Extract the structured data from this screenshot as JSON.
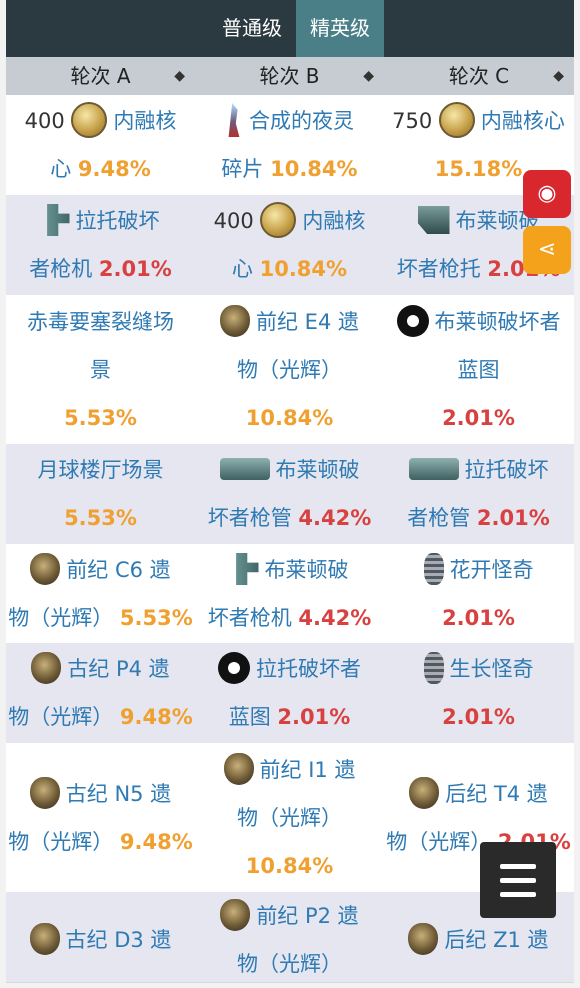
{
  "tabs": {
    "normal": "普通级",
    "elite": "精英级"
  },
  "header": {
    "col_a": "轮次 A",
    "col_b": "轮次 B",
    "col_c": "轮次 C",
    "sort_glyph": "◆"
  },
  "rows": [
    {
      "a": {
        "prefix": "400",
        "icon": "core-icon",
        "l1": "内融核",
        "l2": "心",
        "pct": "9.48%"
      },
      "b": {
        "icon": "night-icon",
        "l1": "合成的夜灵",
        "l2": "碎片",
        "pct": "10.84%"
      },
      "c": {
        "prefix": "750",
        "icon": "core-icon",
        "l1": "内融核心",
        "l2": "",
        "pct": "15.18%"
      }
    },
    {
      "a": {
        "icon": "receiver-icon",
        "l1": "拉托破坏",
        "l2": "者枪机",
        "pct": "2.01%"
      },
      "b": {
        "prefix": "400",
        "icon": "core-icon",
        "l1": "内融核",
        "l2": "心",
        "pct": "10.84%"
      },
      "c": {
        "icon": "stock-icon",
        "l1": "布莱顿破",
        "l2": "坏者枪托",
        "pct": "2.01%"
      }
    },
    {
      "a": {
        "l1": "赤毒要塞裂缝场",
        "l2": "景",
        "pct": "5.53%"
      },
      "b": {
        "icon": "relic-icon",
        "l1": "前纪 E4 遗",
        "l2": "物（光辉）",
        "l3": "",
        "pct": "10.84%"
      },
      "c": {
        "icon": "blueprint-icon",
        "l1": "布莱顿破坏者",
        "l2": "蓝图",
        "pct": "2.01%"
      }
    },
    {
      "a": {
        "l1": "月球楼厅场景",
        "l2": "",
        "pct": "5.53%"
      },
      "b": {
        "icon": "barrel-icon",
        "l1": "布莱顿破",
        "l2": "坏者枪管",
        "pct": "4.42%"
      },
      "c": {
        "icon": "barrel-icon",
        "l1": "拉托破坏",
        "l2": "者枪管",
        "pct": "2.01%"
      }
    },
    {
      "a": {
        "icon": "relic-icon",
        "l1": "前纪 C6 遗",
        "l2": "物（光辉）",
        "pct": "5.53%"
      },
      "b": {
        "icon": "receiver-icon",
        "l1": "布莱顿破",
        "l2": "坏者枪机",
        "pct": "4.42%"
      },
      "c": {
        "icon": "bloom-icon",
        "l1": "花开怪奇",
        "l2": "",
        "pct": "2.01%"
      }
    },
    {
      "a": {
        "icon": "relic-icon",
        "l1": "古纪 P4 遗",
        "l2": "物（光辉）",
        "pct": "9.48%"
      },
      "b": {
        "icon": "blueprint-icon",
        "l1": "拉托破坏者",
        "l2": "蓝图",
        "pct": "2.01%"
      },
      "c": {
        "icon": "bloom-icon",
        "l1": "生长怪奇",
        "l2": "",
        "pct": "2.01%"
      }
    },
    {
      "a": {
        "icon": "relic-icon",
        "l1": "古纪 N5 遗",
        "l2": "物（光辉）",
        "pct": "9.48%"
      },
      "b": {
        "icon": "relic-icon",
        "l1": "前纪 I1 遗",
        "l2": "物（光辉）",
        "pct": "10.84%"
      },
      "c": {
        "icon": "relic-icon",
        "l1": "后纪 T4 遗",
        "l2": "物（光辉）",
        "pct": "2.01%"
      }
    },
    {
      "a": {
        "icon": "relic-icon",
        "l1": "古纪 D3 遗"
      },
      "b": {
        "icon": "relic-icon",
        "l1": "前纪 P2 遗",
        "l2": "物（光辉）"
      },
      "c": {
        "icon": "relic-icon",
        "l1": "后纪 Z1 遗"
      }
    }
  ],
  "colors": {
    "tab_bg": "#2b3a40",
    "tab_active": "#4a7f88",
    "link": "#2f7ab3",
    "pct_orange": "#f0a030",
    "pct_red": "#d94040"
  },
  "fab": {
    "weibo_icon": "weibo-icon",
    "share_icon": "share-icon",
    "menu_icon": "menu-icon"
  }
}
